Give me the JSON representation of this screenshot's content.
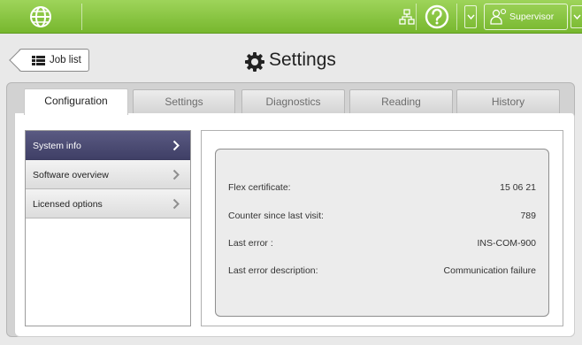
{
  "topbar": {
    "user_label": "Supervisor",
    "accent": "#86c43e",
    "icons": [
      "globe-icon",
      "network-icon",
      "help-icon",
      "chevron-down-icon",
      "user-icon"
    ]
  },
  "header": {
    "back_label": "Job list",
    "title": "Settings",
    "title_icon": "gear-icon"
  },
  "tabs": [
    {
      "label": "Configuration",
      "active": true
    },
    {
      "label": "Settings",
      "active": false
    },
    {
      "label": "Diagnostics",
      "active": false
    },
    {
      "label": "Reading",
      "active": false
    },
    {
      "label": "History",
      "active": false
    }
  ],
  "menu": {
    "items": [
      {
        "label": "System info",
        "active": true
      },
      {
        "label": "Software overview",
        "active": false
      },
      {
        "label": "Licensed options",
        "active": false
      }
    ],
    "active_color": "#4a4a72"
  },
  "info": {
    "rows": [
      {
        "key": "Flex certificate:",
        "value": "15 06 21"
      },
      {
        "key": "Counter since last visit:",
        "value": "789"
      },
      {
        "key": "Last error :",
        "value": "INS-COM-900"
      },
      {
        "key": "Last error description:",
        "value": "Communication failure"
      }
    ]
  }
}
